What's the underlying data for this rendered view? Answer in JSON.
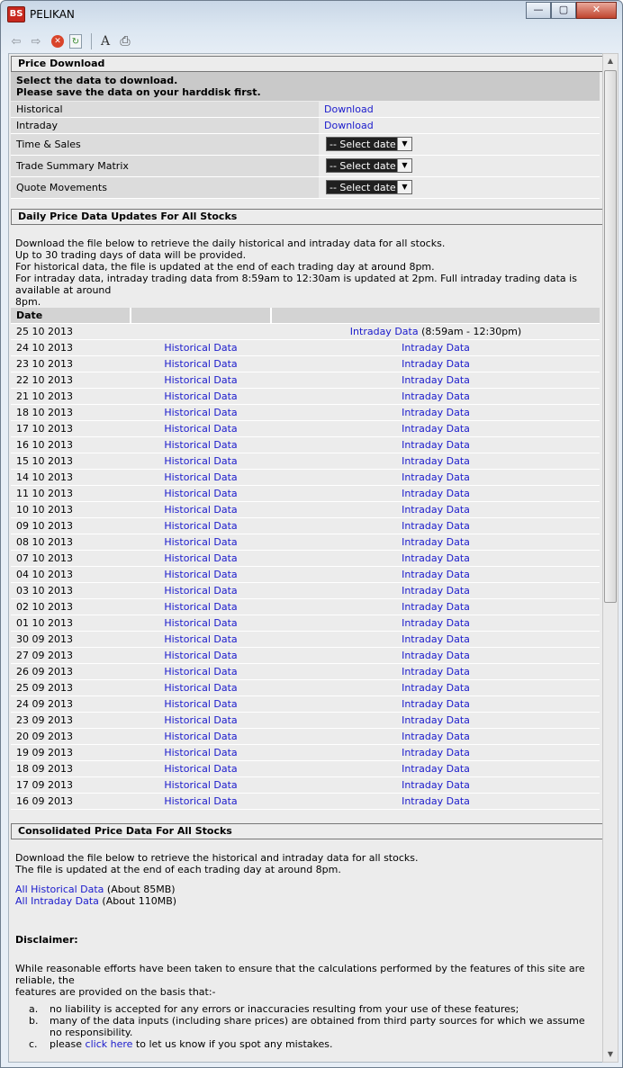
{
  "window": {
    "title": "PELIKAN",
    "icon_label": "BS",
    "minimize": "—",
    "maximize": "▢",
    "close": "✕"
  },
  "toolbar": {
    "back": "⇦",
    "forward": "⇨",
    "stop": "✕",
    "refresh": "↻",
    "font": "A",
    "print": "⎙"
  },
  "price_download": {
    "heading": "Price Download",
    "intro_line1": "Select the data to download.",
    "intro_line2": "Please save the data on your harddisk first.",
    "rows": [
      {
        "label": "Historical",
        "action": "Download"
      },
      {
        "label": "Intraday",
        "action": "Download"
      },
      {
        "label": "Time & Sales",
        "select": "-- Select date --"
      },
      {
        "label": "Trade Summary Matrix",
        "select": "-- Select date --"
      },
      {
        "label": "Quote Movements",
        "select": "-- Select date --"
      }
    ]
  },
  "daily": {
    "heading": "Daily Price Data Updates For All Stocks",
    "lines": [
      "Download the file below to retrieve the daily historical and intraday data for all stocks.",
      "Up to 30 trading days of data will be provided.",
      "For historical data, the file is updated at the end of each trading day at around 8pm.",
      "For intraday data, intraday trading data from 8:59am to 12:30am is updated at 2pm. Full intraday trading data is available at around",
      "8pm."
    ],
    "col_date": "Date",
    "first_row": {
      "date": "25 10 2013",
      "intraday": "Intraday Data",
      "note": " (8:59am - 12:30pm)"
    },
    "hist_label": "Historical Data",
    "intra_label": "Intraday Data",
    "dates": [
      "24 10 2013",
      "23 10 2013",
      "22 10 2013",
      "21 10 2013",
      "18 10 2013",
      "17 10 2013",
      "16 10 2013",
      "15 10 2013",
      "14 10 2013",
      "11 10 2013",
      "10 10 2013",
      "09 10 2013",
      "08 10 2013",
      "07 10 2013",
      "04 10 2013",
      "03 10 2013",
      "02 10 2013",
      "01 10 2013",
      "30 09 2013",
      "27 09 2013",
      "26 09 2013",
      "25 09 2013",
      "24 09 2013",
      "23 09 2013",
      "20 09 2013",
      "19 09 2013",
      "18 09 2013",
      "17 09 2013",
      "16 09 2013"
    ]
  },
  "consolidated": {
    "heading": "Consolidated Price Data For All Stocks",
    "line1": "Download the file below to retrieve the historical and intraday data for all stocks.",
    "line2": "The file is updated at the end of each trading day at around 8pm.",
    "hist_link": "All Historical Data",
    "hist_size": " (About 85MB)",
    "intra_link": "All Intraday Data",
    "intra_size": " (About 110MB)"
  },
  "disclaimer": {
    "heading": "Disclaimer:",
    "p1a": "While reasonable efforts have been taken to ensure that the calculations performed by the features of this site are reliable, the",
    "p1b": "features are provided on the basis that:-",
    "items": [
      {
        "marker": "a.",
        "text": "no liability is accepted for any errors or inaccuracies resulting from your use of these features;"
      },
      {
        "marker": "b.",
        "text": "many of the data inputs (including share prices) are obtained from third party sources for which we assume no responsibility."
      }
    ],
    "item_c_marker": "c.",
    "item_c_pre": "please ",
    "item_c_link": "click here",
    "item_c_post": " to let us know if you spot any mistakes."
  }
}
